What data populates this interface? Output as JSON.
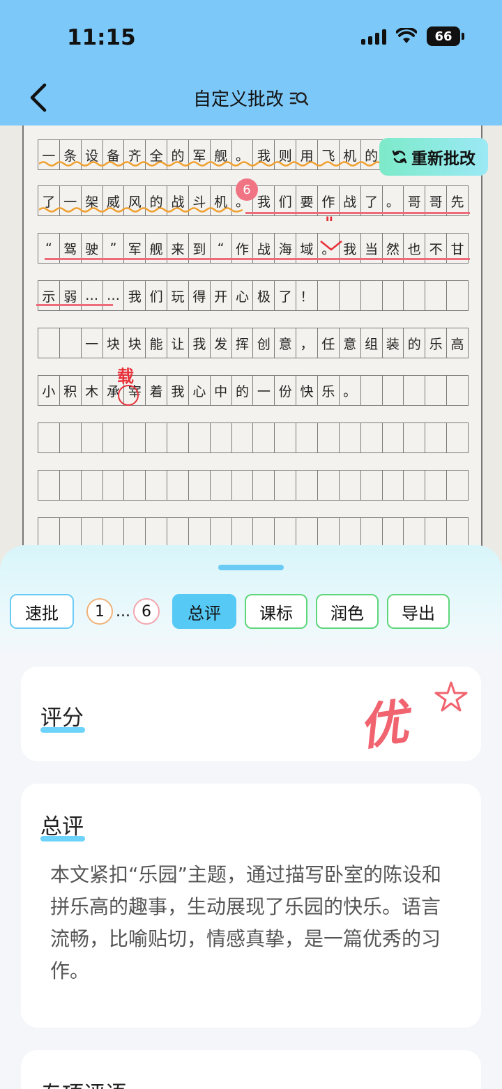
{
  "status_bar": {
    "time": "11:15",
    "battery": "66"
  },
  "nav": {
    "title": "自定义批改"
  },
  "essay": {
    "lines": [
      [
        "一",
        "条",
        "设",
        "备",
        "齐",
        "全",
        "的",
        "军",
        "舰",
        "。",
        "我",
        "则",
        "用",
        "飞",
        "机",
        "的",
        "",
        "",
        "",
        ""
      ],
      [
        "了",
        "一",
        "架",
        "威",
        "风",
        "的",
        "战",
        "斗",
        "机",
        "。",
        "我",
        "们",
        "要",
        "作",
        "战",
        "了",
        "。",
        "哥",
        "哥",
        "先"
      ],
      [
        "“",
        "驾",
        "驶",
        "”",
        "军",
        "舰",
        "来",
        "到",
        "“",
        "作",
        "战",
        "海",
        "域",
        "。",
        "我",
        "当",
        "然",
        "也",
        "不",
        "甘"
      ],
      [
        "示",
        "弱",
        "…",
        "…",
        "我",
        "们",
        "玩",
        "得",
        "开",
        "心",
        "极",
        "了",
        "！",
        "",
        "",
        "",
        "",
        "",
        "",
        ""
      ],
      [
        "",
        "",
        "一",
        "块",
        "块",
        "能",
        "让",
        "我",
        "发",
        "挥",
        "创",
        "意",
        "，",
        "任",
        "意",
        "组",
        "装",
        "的",
        "乐",
        "高"
      ],
      [
        "小",
        "积",
        "木",
        "承",
        "宰",
        "着",
        "我",
        "心",
        "中",
        "的",
        "一",
        "份",
        "快",
        "乐",
        "。",
        "",
        "",
        "",
        "",
        ""
      ],
      [
        "",
        "",
        "",
        "",
        "",
        "",
        "",
        "",
        "",
        "",
        "",
        "",
        "",
        "",
        "",
        "",
        "",
        "",
        "",
        ""
      ],
      [
        "",
        "",
        "",
        "",
        "",
        "",
        "",
        "",
        "",
        "",
        "",
        "",
        "",
        "",
        "",
        "",
        "",
        "",
        "",
        ""
      ],
      [
        "",
        "",
        "",
        "",
        "",
        "",
        "",
        "",
        "",
        "",
        "",
        "",
        "",
        "",
        "",
        "",
        "",
        "",
        "",
        ""
      ]
    ],
    "marker_number": "6",
    "correction": "载",
    "insert_quote": "\""
  },
  "actions": {
    "rebatch_label": "重新批改"
  },
  "toolbar": {
    "quick_label": "速批",
    "page_first": "1",
    "page_ellipsis": "...",
    "page_last": "6",
    "tabs": [
      "总评",
      "课标",
      "润色",
      "导出"
    ]
  },
  "score_card": {
    "title": "评分",
    "grade": "优"
  },
  "summary_card": {
    "title": "总评",
    "text": "本文紧扣“乐园”主题，通过描写卧室的陈设和拼乐高的趣事，生动展现了乐园的快乐。语言流畅，比喻贴切，情感真挚，是一篇优秀的习作。"
  },
  "next_section": {
    "title": "专项评语"
  },
  "colors": {
    "header": "#7cc8f8",
    "accent": "#57c9f5",
    "grade_red": "#f0636f",
    "correction_red": "#e8303a"
  }
}
